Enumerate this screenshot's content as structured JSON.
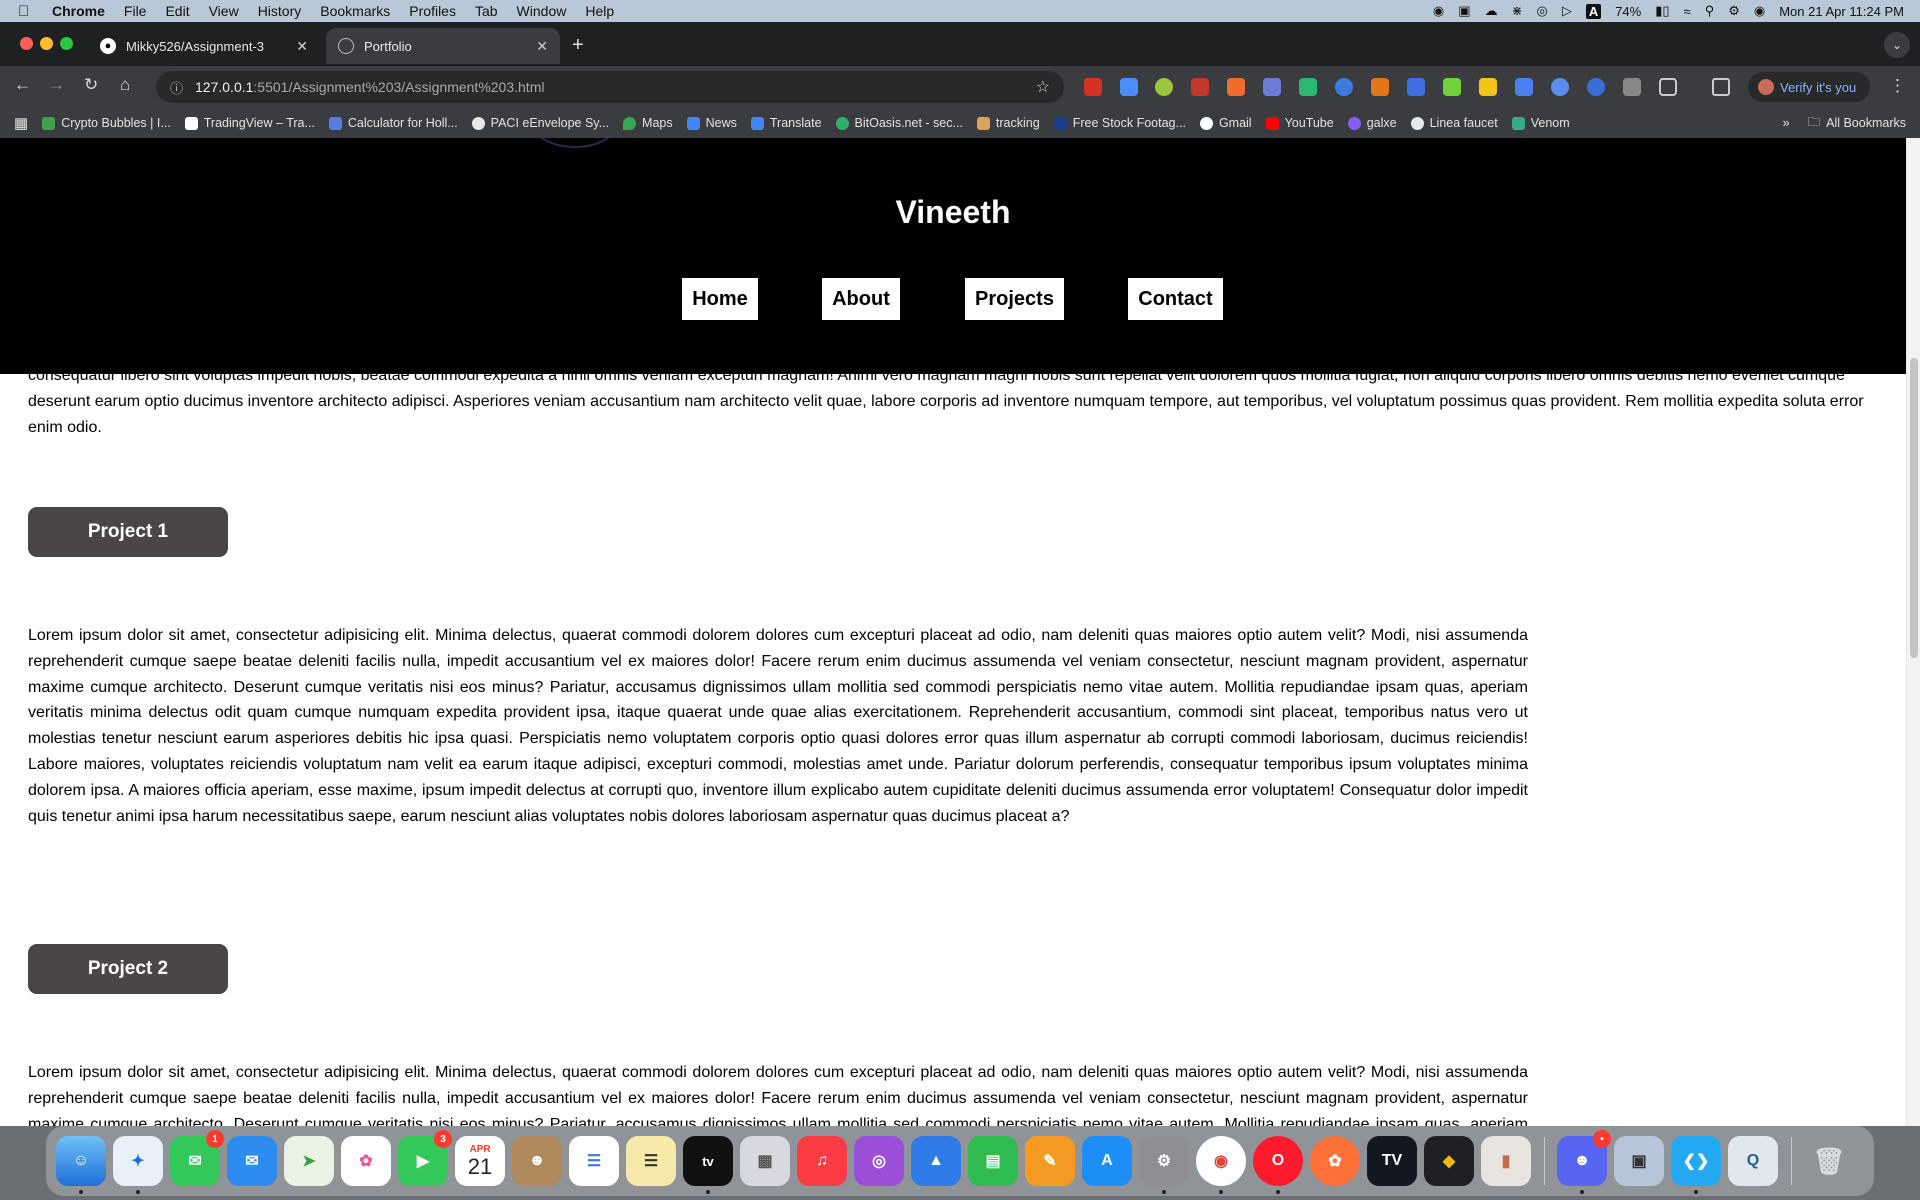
{
  "menubar": {
    "apple": "",
    "items": [
      "Chrome",
      "File",
      "Edit",
      "View",
      "History",
      "Bookmarks",
      "Profiles",
      "Tab",
      "Window",
      "Help"
    ],
    "battery": "74%",
    "datetime": "Mon 21 Apr  11:24 PM"
  },
  "tabs": [
    {
      "title": "Mikky526/Assignment-3",
      "icon": "github-icon"
    },
    {
      "title": "Portfolio",
      "icon": "globe-icon"
    }
  ],
  "address": {
    "host": "127.0.0.1",
    "path": ":5501/Assignment%203/Assignment%203.html"
  },
  "verify_label": "Verify it's you",
  "bookmarks": [
    {
      "label": "Crypto Bubbles | I...",
      "color": "#3fa34d"
    },
    {
      "label": "TradingView – Tra...",
      "color": "#222"
    },
    {
      "label": "Calculator for Holl...",
      "color": "#5a7be0"
    },
    {
      "label": "PACI eEnvelope Sy...",
      "color": "#e8e8e8"
    },
    {
      "label": "Maps",
      "color": "#34a853"
    },
    {
      "label": "News",
      "color": "#4285f4"
    },
    {
      "label": "Translate",
      "color": "#4285f4"
    },
    {
      "label": "BitOasis.net - sec...",
      "color": "#2eaf6a"
    },
    {
      "label": "tracking",
      "color": "#d9a45b"
    },
    {
      "label": "Free Stock Footag...",
      "color": "#1d3e8a"
    },
    {
      "label": "Gmail",
      "color": "#ea4335"
    },
    {
      "label": "YouTube",
      "color": "#ff0000"
    },
    {
      "label": "galxe",
      "color": "#8a5cf6"
    },
    {
      "label": "Linea faucet",
      "color": "#e8e8e8"
    },
    {
      "label": "Venom",
      "color": "#3aa98a"
    }
  ],
  "all_bookmarks": "All Bookmarks",
  "site": {
    "title": "Vineeth",
    "nav": [
      "Home",
      "About",
      "Projects",
      "Contact"
    ]
  },
  "page": {
    "top_paragraph": "consequatur libero sint voluptas impedit nobis, beatae commodi expedita a nihil omnis veniam excepturi magnam! Animi vero magnam magni nobis sunt repellat velit dolorem quos mollitia fugiat, non aliquid corporis libero omnis debitis nemo eveniet cumque deserunt earum optio ducimus inventore architecto adipisci. Asperiores veniam accusantium nam architecto velit quae, labore corporis ad inventore numquam tempore, aut temporibus, vel voluptatum possimus quas provident. Rem mollitia expedita soluta error enim odio.",
    "projects": [
      {
        "label": "Project 1",
        "text": "Lorem ipsum dolor sit amet, consectetur adipisicing elit. Minima delectus, quaerat commodi dolorem dolores cum excepturi placeat ad odio, nam deleniti quas maiores optio autem velit? Modi, nisi assumenda reprehenderit cumque saepe beatae deleniti facilis nulla, impedit accusantium vel ex maiores dolor! Facere rerum enim ducimus assumenda vel veniam consectetur, nesciunt magnam provident, aspernatur maxime cumque architecto. Deserunt cumque veritatis nisi eos minus? Pariatur, accusamus dignissimos ullam mollitia sed commodi perspiciatis nemo vitae autem. Mollitia repudiandae ipsam quas, aperiam veritatis minima delectus odit quam cumque numquam expedita provident ipsa, itaque quaerat unde quae alias exercitationem. Reprehenderit accusantium, commodi sint placeat, temporibus natus vero ut molestias tenetur nesciunt earum asperiores debitis hic ipsa quasi. Perspiciatis nemo voluptatem corporis optio quasi dolores error quas illum aspernatur ab corrupti commodi laboriosam, ducimus reiciendis! Labore maiores, voluptates reiciendis voluptatum nam velit ea earum itaque adipisci, excepturi commodi, molestias amet unde. Pariatur dolorum perferendis, consequatur temporibus ipsum voluptates minima dolorem ipsa. A maiores officia aperiam, esse maxime, ipsum impedit delectus at corrupti quo, inventore illum explicabo autem cupiditate deleniti ducimus assumenda error voluptatem! Consequatur dolor impedit quis tenetur animi ipsa harum necessitatibus saepe, earum nesciunt alias voluptates nobis dolores laboriosam aspernatur quas ducimus placeat a?"
      },
      {
        "label": "Project 2",
        "text": "Lorem ipsum dolor sit amet, consectetur adipisicing elit. Minima delectus, quaerat commodi dolorem dolores cum excepturi placeat ad odio, nam deleniti quas maiores optio autem velit? Modi, nisi assumenda reprehenderit cumque saepe beatae deleniti facilis nulla, impedit accusantium vel ex maiores dolor! Facere rerum enim ducimus assumenda vel veniam consectetur, nesciunt magnam provident, aspernatur maxime cumque architecto. Deserunt cumque veritatis nisi eos minus? Pariatur, accusamus dignissimos ullam mollitia sed commodi perspiciatis nemo vitae autem. Mollitia repudiandae ipsam quas, aperiam veritatis minima delectus odit quam cumque numquam expedita provident ipsa, itaque quaerat unde quae alias exercitationem. Reprehenderit accusantium, commodi sint placeat, temporibus natus vero ut"
      }
    ]
  },
  "dock": {
    "calendar_month": "APR",
    "calendar_day": "21",
    "messages_badge": "1",
    "facetime_badge": "3",
    "discord_badge": "•"
  }
}
